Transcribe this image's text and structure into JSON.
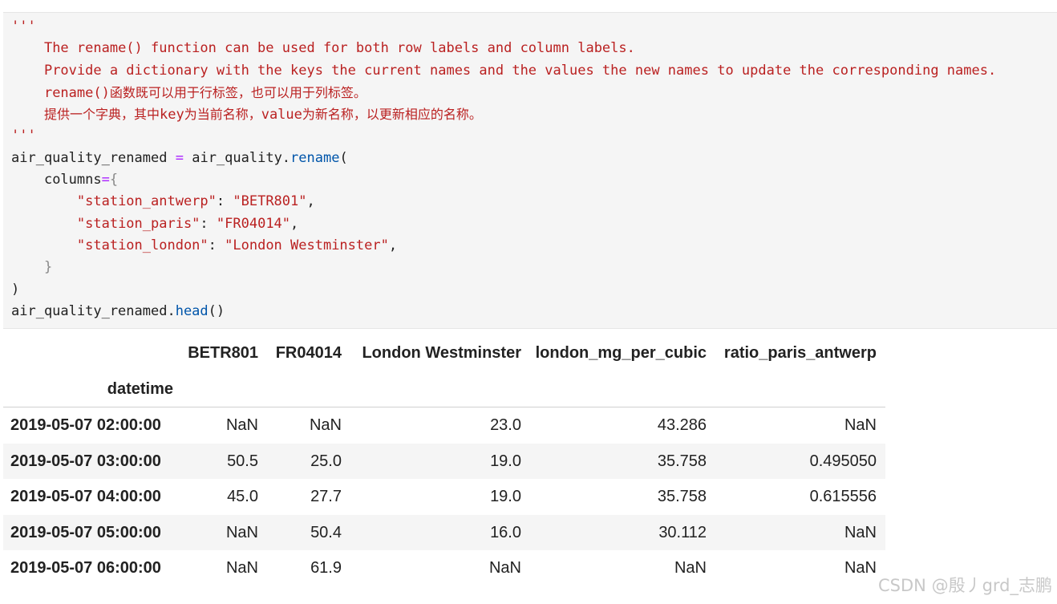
{
  "code": {
    "docstring_open": "'''",
    "doc_line_1": "The rename() function can be used for both row labels and column labels.",
    "doc_line_2": "Provide a dictionary with the keys the current names and the values the new names to update the corresponding names.",
    "doc_line_3_code": "rename()",
    "doc_line_3_text": "函数既可以用于行标签，也可以用于列标签。",
    "doc_line_4_a": "提供一个字典，其中",
    "doc_line_4_b": "key",
    "doc_line_4_c": "为当前名称，",
    "doc_line_4_d": "value",
    "doc_line_4_e": "为新名称，以更新相应的名称。",
    "docstring_close": "'''",
    "assign_var": "air_quality_renamed",
    "assign_op": "=",
    "call_obj": "air_quality.",
    "call_fn": "rename",
    "open_paren": "(",
    "kw_name": "columns",
    "kw_eq": "=",
    "open_brace": "{",
    "map": [
      {
        "key": "\"station_antwerp\"",
        "value": "\"BETR801\""
      },
      {
        "key": "\"station_paris\"",
        "value": "\"FR04014\""
      },
      {
        "key": "\"station_london\"",
        "value": "\"London Westminster\""
      }
    ],
    "colon": ": ",
    "comma": ",",
    "close_brace": "}",
    "close_paren": ")",
    "head_obj": "air_quality_renamed.",
    "head_fn": "head",
    "head_parens": "()"
  },
  "table": {
    "columns": [
      "BETR801",
      "FR04014",
      "London Westminster",
      "london_mg_per_cubic",
      "ratio_paris_antwerp"
    ],
    "index_name": "datetime",
    "rows": [
      {
        "index": "2019-05-07 02:00:00",
        "values": [
          "NaN",
          "NaN",
          "23.0",
          "43.286",
          "NaN"
        ]
      },
      {
        "index": "2019-05-07 03:00:00",
        "values": [
          "50.5",
          "25.0",
          "19.0",
          "35.758",
          "0.495050"
        ]
      },
      {
        "index": "2019-05-07 04:00:00",
        "values": [
          "45.0",
          "27.7",
          "19.0",
          "35.758",
          "0.615556"
        ]
      },
      {
        "index": "2019-05-07 05:00:00",
        "values": [
          "NaN",
          "50.4",
          "16.0",
          "30.112",
          "NaN"
        ]
      },
      {
        "index": "2019-05-07 06:00:00",
        "values": [
          "NaN",
          "61.9",
          "NaN",
          "NaN",
          "NaN"
        ]
      }
    ]
  },
  "watermark": "CSDN @殷丿grd_志鹏",
  "colors": {
    "string": "#ba2121",
    "operator": "#aa22ff",
    "function": "#0055aa",
    "cell_bg": "#f5f5f5"
  }
}
